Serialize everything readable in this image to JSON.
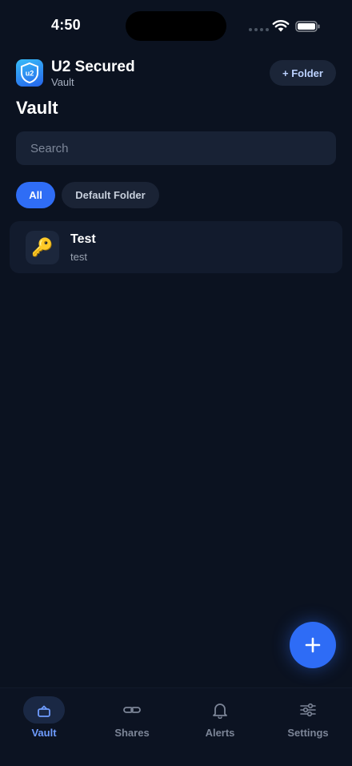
{
  "status_bar": {
    "time": "4:50"
  },
  "header": {
    "app_name": "U2 Secured",
    "app_subtitle": "Vault",
    "folder_button": "+ Folder",
    "logo_text": "u2"
  },
  "page_title": "Vault",
  "search": {
    "placeholder": "Search"
  },
  "filters": [
    {
      "label": "All",
      "selected": true
    },
    {
      "label": "Default Folder",
      "selected": false
    }
  ],
  "items": [
    {
      "title": "Test",
      "subtitle": "test",
      "icon": "key-icon"
    }
  ],
  "fab": {
    "icon": "plus-icon"
  },
  "tabs": [
    {
      "label": "Vault",
      "icon": "lock-icon",
      "active": true
    },
    {
      "label": "Shares",
      "icon": "link-icon",
      "active": false
    },
    {
      "label": "Alerts",
      "icon": "bell-icon",
      "active": false
    },
    {
      "label": "Settings",
      "icon": "sliders-icon",
      "active": false
    }
  ],
  "colors": {
    "background": "#0b1220",
    "accent": "#2f6df5",
    "active_tab": "#6f9cff",
    "inactive_tab": "#7c8597"
  }
}
